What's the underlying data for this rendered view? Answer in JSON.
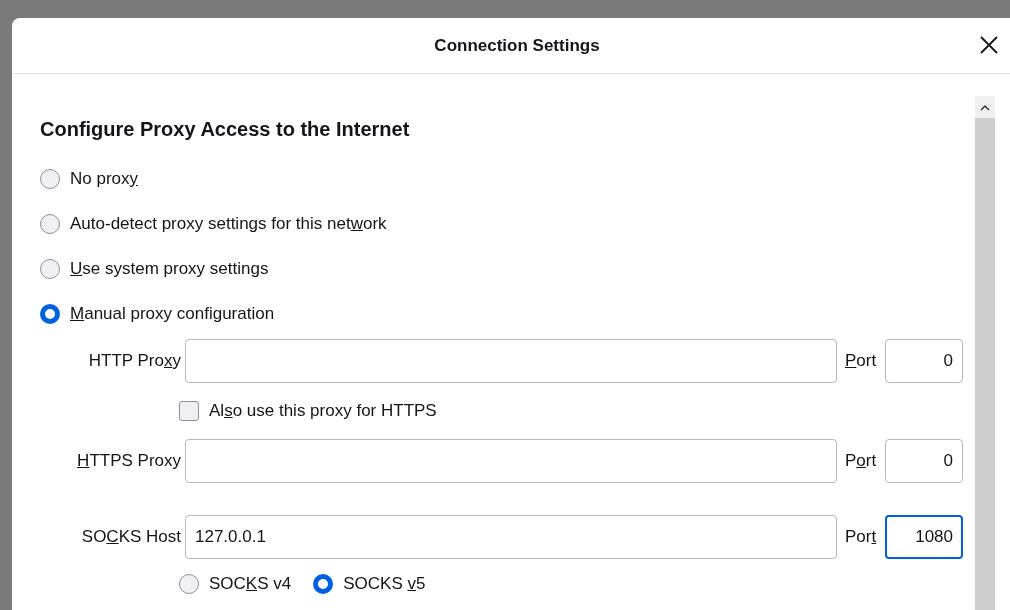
{
  "dialog": {
    "title": "Connection Settings"
  },
  "heading": "Configure Proxy Access to the Internet",
  "proxy_modes": [
    {
      "label": {
        "pre": "No prox",
        "key": "y"
      },
      "selected": false
    },
    {
      "label": {
        "pre": "Auto-detect proxy settings for this net",
        "key": "w",
        "post": "ork"
      },
      "selected": false
    },
    {
      "label": {
        "key": "U",
        "post": "se system proxy settings"
      },
      "selected": false
    },
    {
      "label": {
        "key": "M",
        "post": "anual proxy configuration"
      },
      "selected": true
    }
  ],
  "http_proxy": {
    "label": {
      "pre": "HTTP Pro",
      "key": "x",
      "post": "y"
    },
    "port_label": {
      "key": "P",
      "post": "ort"
    },
    "port": "0",
    "port_focused": false
  },
  "also_https": {
    "label": {
      "pre": "Al",
      "key": "s",
      "post": "o use this proxy for HTTPS"
    },
    "checked": false
  },
  "https_proxy": {
    "label": {
      "key": "H",
      "post": "TTPS Proxy"
    },
    "port_label": {
      "pre": "P",
      "key": "o",
      "post": "rt"
    },
    "port": "0",
    "port_focused": false
  },
  "socks_host": {
    "label": {
      "pre": "SO",
      "key": "C",
      "post": "KS Host"
    },
    "value": "127.0.0.1",
    "port_label": {
      "pre": "Por",
      "key": "t"
    },
    "port": "1080",
    "port_focused": true
  },
  "socks_versions": [
    {
      "label": {
        "pre": "SOC",
        "key": "K",
        "post": "S v4"
      },
      "selected": false
    },
    {
      "label": {
        "pre": "SOCKS ",
        "key": "v",
        "post": "5"
      },
      "selected": true
    }
  ]
}
